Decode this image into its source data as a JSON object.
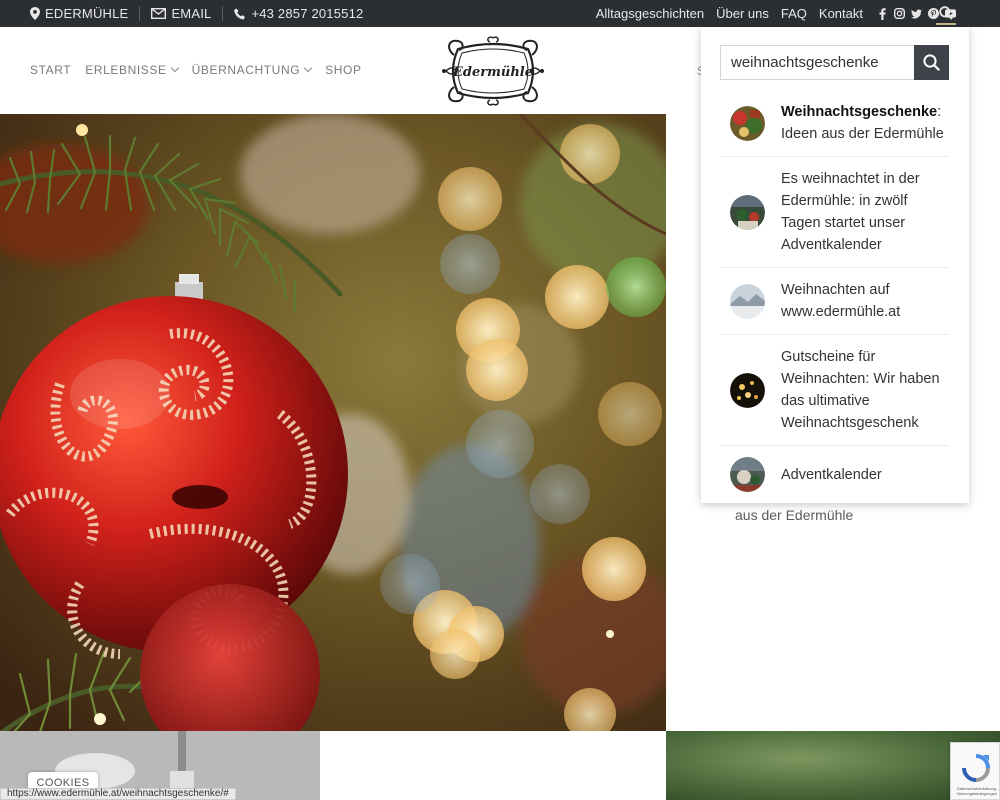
{
  "topbar": {
    "location": "EDERMÜHLE",
    "email": "EMAIL",
    "phone": "+43 2857 2015512",
    "links": [
      "Alltagsgeschichten",
      "Über uns",
      "FAQ",
      "Kontakt"
    ],
    "social_icons": [
      "facebook-icon",
      "instagram-icon",
      "twitter-icon",
      "pinterest-icon",
      "youtube-icon"
    ]
  },
  "nav": {
    "items": [
      {
        "label": "START",
        "dropdown": false
      },
      {
        "label": "ERLEBNISSE",
        "dropdown": true
      },
      {
        "label": "ÜBERNACHTUNG",
        "dropdown": true
      },
      {
        "label": "SHOP",
        "dropdown": false
      }
    ],
    "logo_text": "Edermühle",
    "partial_item": "S"
  },
  "search": {
    "value": "weihnachtsgeschenke",
    "results": [
      {
        "title_bold": "Weihnachtsgeschenke",
        "title_rest": ": Ideen aus der Edermühle"
      },
      {
        "title_bold": "",
        "title_rest": "Es weihnachtet in der Edermühle: in zwölf Tagen startet unser Adventkalender"
      },
      {
        "title_bold": "",
        "title_rest": "Weihnachten auf www.edermühle.at"
      },
      {
        "title_bold": "",
        "title_rest": "Gutscheine für Weihnachten: Wir haben das ultimative Weihnachtsgeschenk"
      },
      {
        "title_bold": "",
        "title_rest": "Adventkalender"
      }
    ]
  },
  "content": {
    "right_text": "aus der Edermühle",
    "cookies_label": "COOKIES",
    "status_url": "https://www.edermühle.at/weihnachtsgeschenke/#",
    "recaptcha_text": "Datenschutzerklärung - Nutzungsbedingungen"
  },
  "colors": {
    "topbar_bg": "#2b2f33",
    "search_button": "#3d4349",
    "accent": "#c9b98b"
  }
}
